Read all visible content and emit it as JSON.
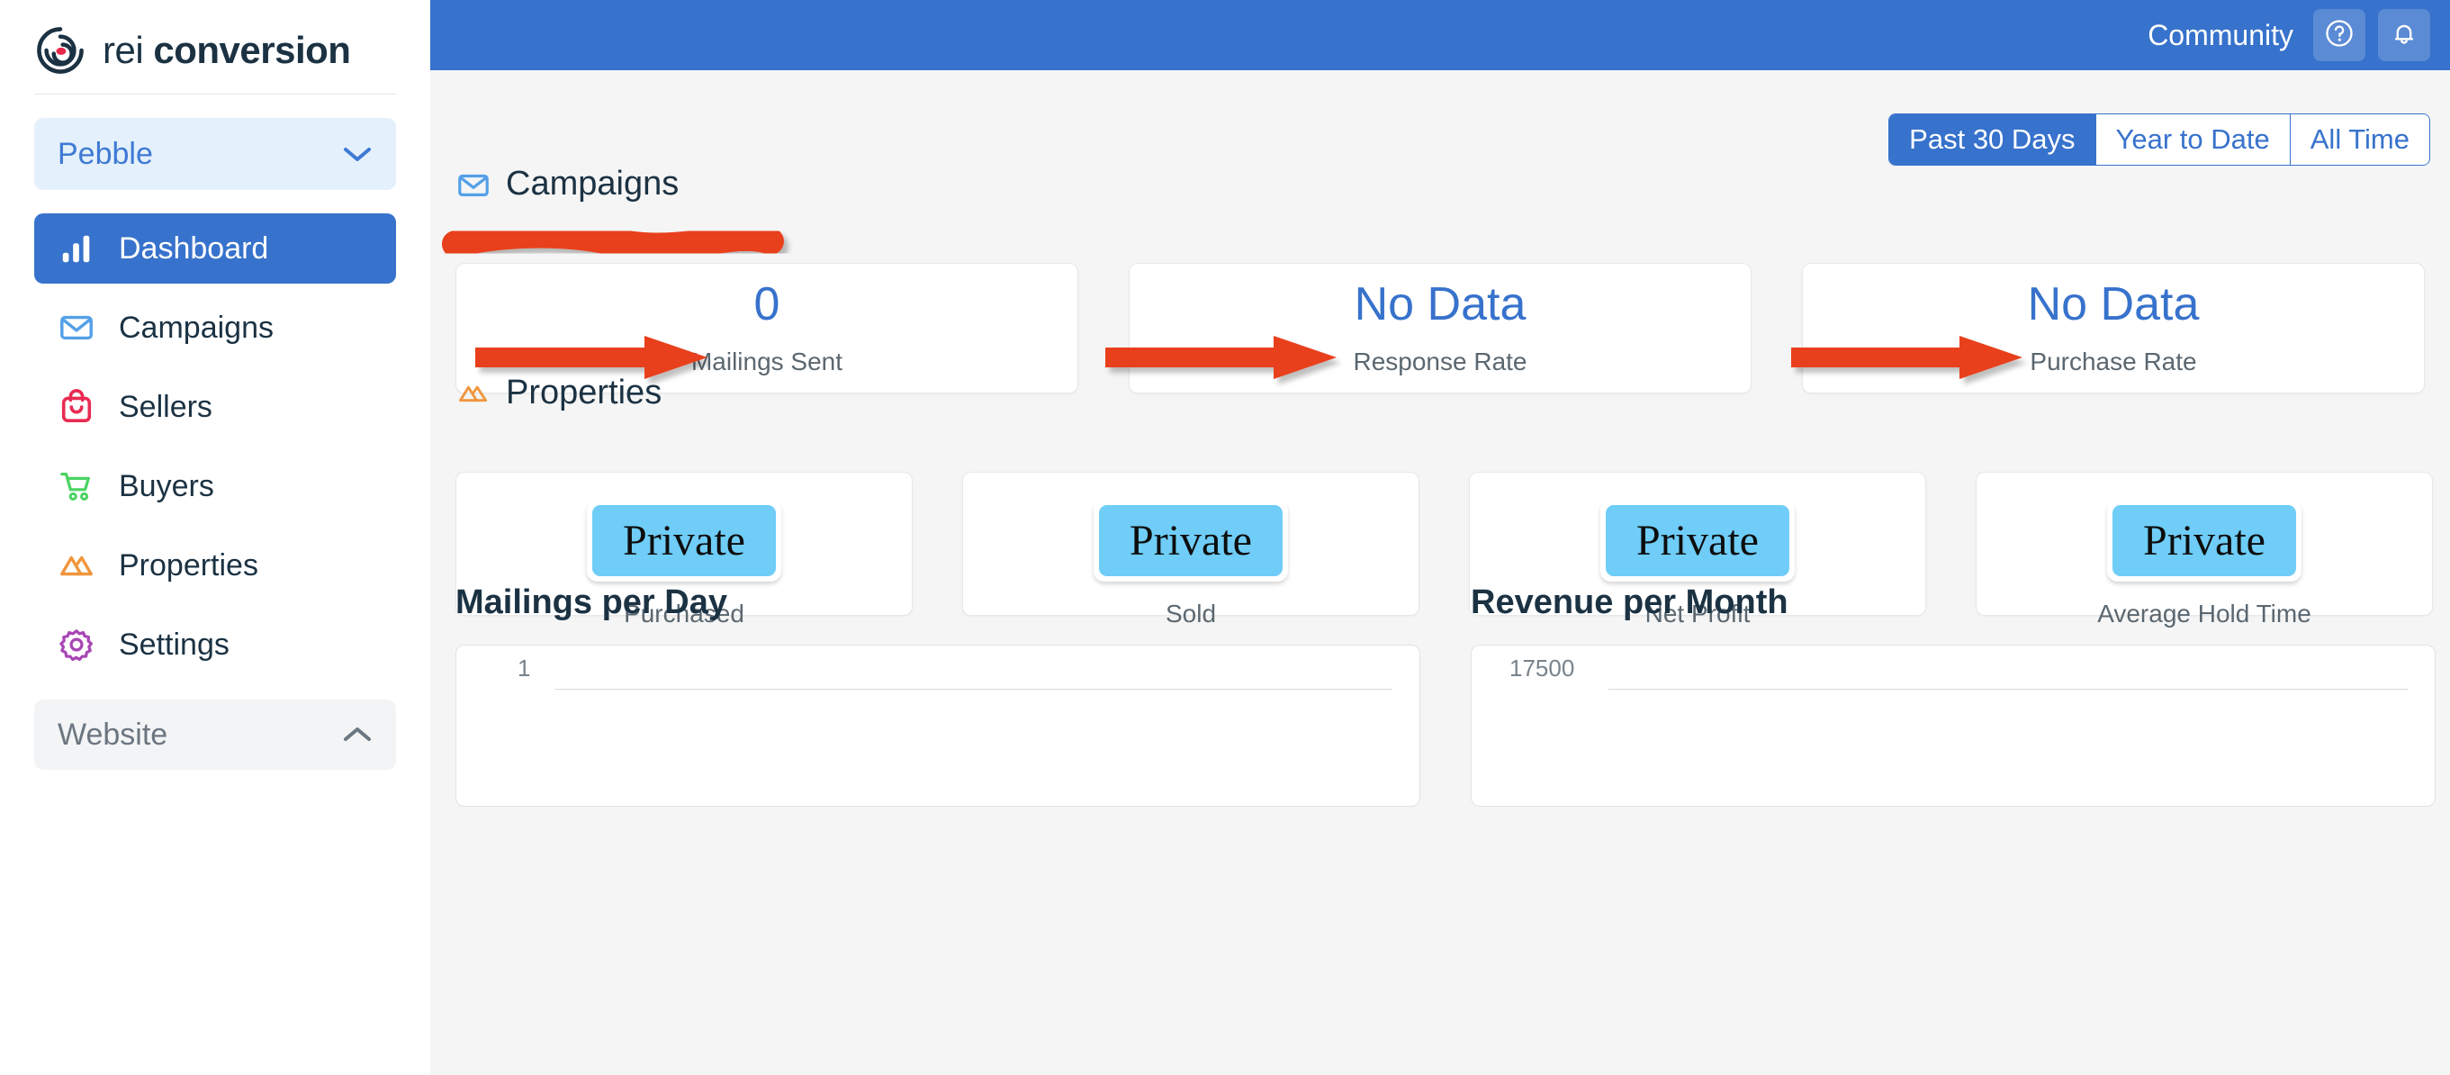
{
  "brand": {
    "light": "rei",
    "bold": "conversion",
    "logo_icon": "spiral-logo-icon"
  },
  "sidebar": {
    "account": {
      "name": "Pebble",
      "chevron_icon": "chevron-down-icon"
    },
    "items": [
      {
        "label": "Dashboard",
        "icon": "bar-chart-icon",
        "active": true
      },
      {
        "label": "Campaigns",
        "icon": "envelope-icon",
        "active": false
      },
      {
        "label": "Sellers",
        "icon": "shopping-bag-icon",
        "active": false
      },
      {
        "label": "Buyers",
        "icon": "shopping-cart-icon",
        "active": false
      },
      {
        "label": "Properties",
        "icon": "mountain-icon",
        "active": false
      },
      {
        "label": "Settings",
        "icon": "gear-icon",
        "active": false
      }
    ],
    "section": {
      "label": "Website",
      "chevron_icon": "chevron-up-icon"
    }
  },
  "topbar": {
    "community_label": "Community",
    "help_icon": "question-circle-icon",
    "notifications_icon": "bell-icon"
  },
  "date_range": {
    "options": [
      "Past 30 Days",
      "Year to Date",
      "All Time"
    ],
    "selected": "Past 30 Days"
  },
  "campaigns": {
    "title": "Campaigns",
    "icon": "envelope-icon",
    "cards": [
      {
        "value": "0",
        "label": "Mailings Sent"
      },
      {
        "value": "No Data",
        "label": "Response Rate"
      },
      {
        "value": "No Data",
        "label": "Purchase Rate"
      }
    ]
  },
  "properties": {
    "title": "Properties",
    "icon": "mountain-icon",
    "cards": [
      {
        "value": "Private",
        "label": "Purchased"
      },
      {
        "value": "Private",
        "label": "Sold"
      },
      {
        "value": "Private",
        "label": "Net Profit"
      },
      {
        "value": "Private",
        "label": "Average Hold Time"
      }
    ]
  },
  "charts": [
    {
      "title": "Mailings per Day",
      "y_top_tick": "1"
    },
    {
      "title": "Revenue per Month",
      "y_top_tick": "17500"
    }
  ],
  "annotations": {
    "color": "#E8401F",
    "marks": [
      {
        "kind": "scribble-underline",
        "target": "campaigns-heading"
      },
      {
        "kind": "arrow",
        "target": "mailings-sent-card"
      },
      {
        "kind": "arrow",
        "target": "response-rate-card"
      },
      {
        "kind": "arrow",
        "target": "purchase-rate-card"
      }
    ]
  },
  "chart_data": [
    {
      "type": "line",
      "title": "Mailings per Day",
      "x": [],
      "values": [],
      "xlabel": "",
      "ylabel": "",
      "ytick_labels": [
        "1"
      ],
      "ylim": [
        0,
        1
      ],
      "grid": false,
      "legend": "none"
    },
    {
      "type": "line",
      "title": "Revenue per Month",
      "x": [],
      "values": [],
      "xlabel": "",
      "ylabel": "",
      "ytick_labels": [
        "17500"
      ],
      "ylim": [
        0,
        17500
      ],
      "grid": false,
      "legend": "none"
    }
  ],
  "colors": {
    "brand_blue": "#3772CC",
    "accent_red": "#E8401F",
    "badge_blue": "#6FCDF7",
    "page_bg": "#F5F5F5",
    "icon_envelope": "#54A0E8",
    "icon_bag": "#E82B52",
    "icon_cart": "#4BD362",
    "icon_mountain": "#F0963C",
    "icon_gear": "#A846B5"
  }
}
